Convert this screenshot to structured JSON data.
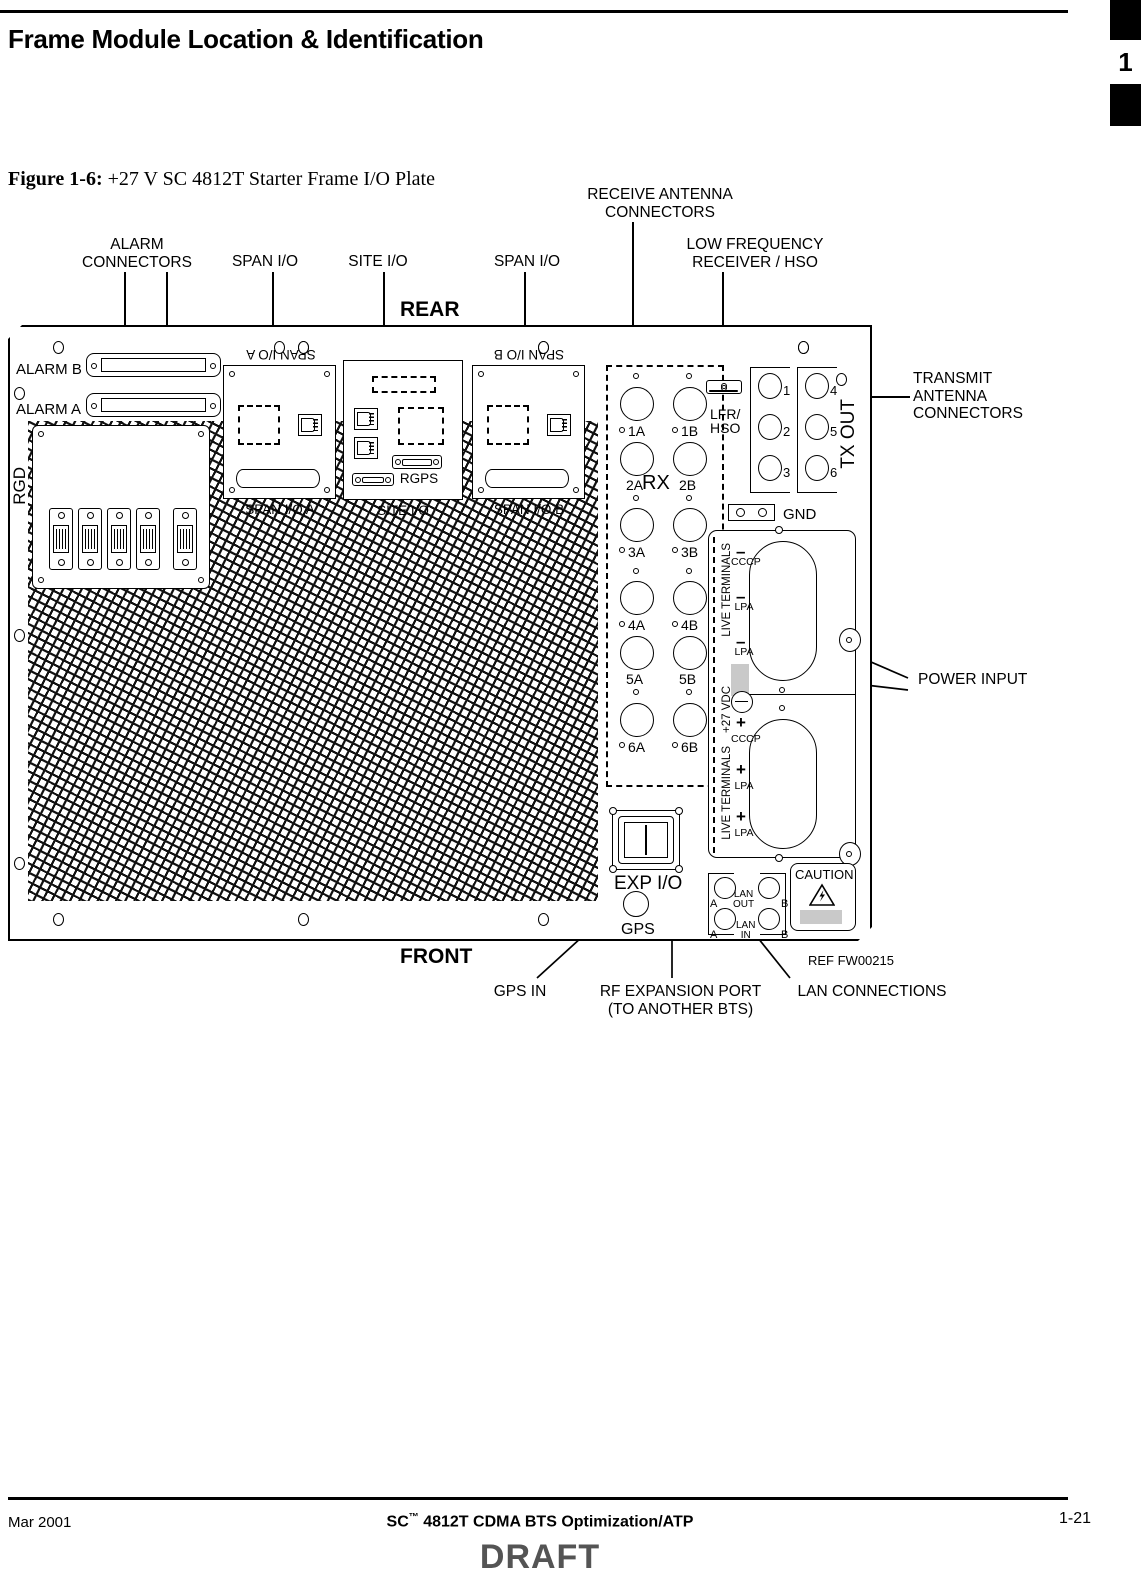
{
  "page": {
    "header_title": "Frame Module Location & Identification",
    "tab_number": "1"
  },
  "figure": {
    "number": "Figure 1-6:",
    "title": "+27 V SC 4812T Starter Frame I/O Plate",
    "orientation_rear": "REAR",
    "orientation_front": "FRONT",
    "reference": "REF  FW00215"
  },
  "callouts": {
    "alarm_connectors": "ALARM\nCONNECTORS",
    "span_io_left": "SPAN I/O",
    "site_io": "SITE I/O",
    "span_io_right": "SPAN I/O",
    "receive_antenna": "RECEIVE ANTENNA\nCONNECTORS",
    "low_frequency": "LOW FREQUENCY\nRECEIVER / HSO",
    "transmit_antenna": "TRANSMIT\nANTENNA\nCONNECTORS",
    "power_input": "POWER INPUT",
    "gps_in": "GPS IN",
    "rf_expansion": "RF EXPANSION PORT\n(TO ANOTHER BTS)",
    "lan_connections": "LAN CONNECTIONS"
  },
  "plate": {
    "rgd_label": "RGD",
    "alarm_b": "ALARM B",
    "alarm_a": "ALARM A",
    "span_io_a_top": "SPAN I/O A",
    "span_io_a_bottom": "SPAN I/O A",
    "span_io_b_top": "SPAN I/O B",
    "span_io_b_bottom": "SPAN I/O B",
    "site_io_bottom": "SITE I/O",
    "rgps": "RGPS",
    "lfr_hso": "LFR/\nHSO",
    "rx_label": "RX",
    "tx_out_label": "TX OUT",
    "gnd_label": "GND",
    "exp_io_label": "EXP I/O",
    "gps_label": "GPS",
    "caution_label": "CAUTION",
    "vdc_label": "+27 VDC",
    "live_terminals_label": "LIVE TERMINALS",
    "rx_connectors": [
      "1A",
      "1B",
      "2A",
      "2B",
      "3A",
      "3B",
      "4A",
      "4B",
      "5A",
      "5B",
      "6A",
      "6B"
    ],
    "tx_connectors": [
      "1",
      "4",
      "2",
      "5",
      "3",
      "6"
    ],
    "live_terminal_tags_top": [
      "CCCP",
      "LPA",
      "LPA"
    ],
    "live_terminal_tags_bottom": [
      "CCCP",
      "LPA",
      "LPA"
    ],
    "live_terminal_sign_top": "–",
    "live_terminal_sign_bottom": "+",
    "lan": {
      "out_label": "LAN\nOUT",
      "in_label": "LAN\nIN",
      "out_a": "A",
      "out_b": "B",
      "in_a": "A",
      "in_b": "B"
    }
  },
  "footer": {
    "date": "Mar 2001",
    "document": "SC 4812T CDMA BTS Optimization/ATP",
    "trademark": "™",
    "page_number": "1-21",
    "watermark": "DRAFT"
  }
}
